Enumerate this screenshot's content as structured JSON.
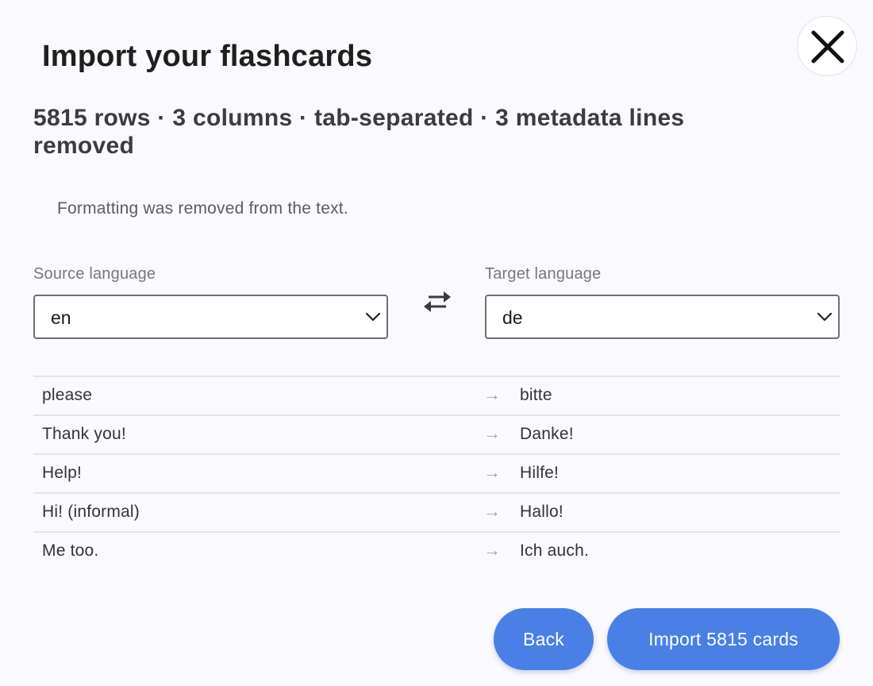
{
  "dialog": {
    "title": "Import your flashcards",
    "summary": "5815 rows · 3 columns · tab-separated · 3 metadata lines removed",
    "notice": "Formatting was removed from the text."
  },
  "source": {
    "label": "Source language",
    "value": "en"
  },
  "target": {
    "label": "Target language",
    "value": "de"
  },
  "preview": {
    "arrow": "→",
    "rows": [
      {
        "source": "please",
        "target": "bitte"
      },
      {
        "source": "Thank you!",
        "target": "Danke!"
      },
      {
        "source": "Help!",
        "target": "Hilfe!"
      },
      {
        "source": "Hi! (informal)",
        "target": "Hallo!"
      },
      {
        "source": "Me too.",
        "target": "Ich auch."
      }
    ]
  },
  "actions": {
    "back_label": "Back",
    "import_label": "Import 5815 cards"
  },
  "icons": {
    "close": "close-icon",
    "swap": "swap-arrows-icon",
    "dropdown": "chevron-down-icon"
  },
  "colors": {
    "accent": "#4a7fe6",
    "background": "#faf9fd"
  }
}
